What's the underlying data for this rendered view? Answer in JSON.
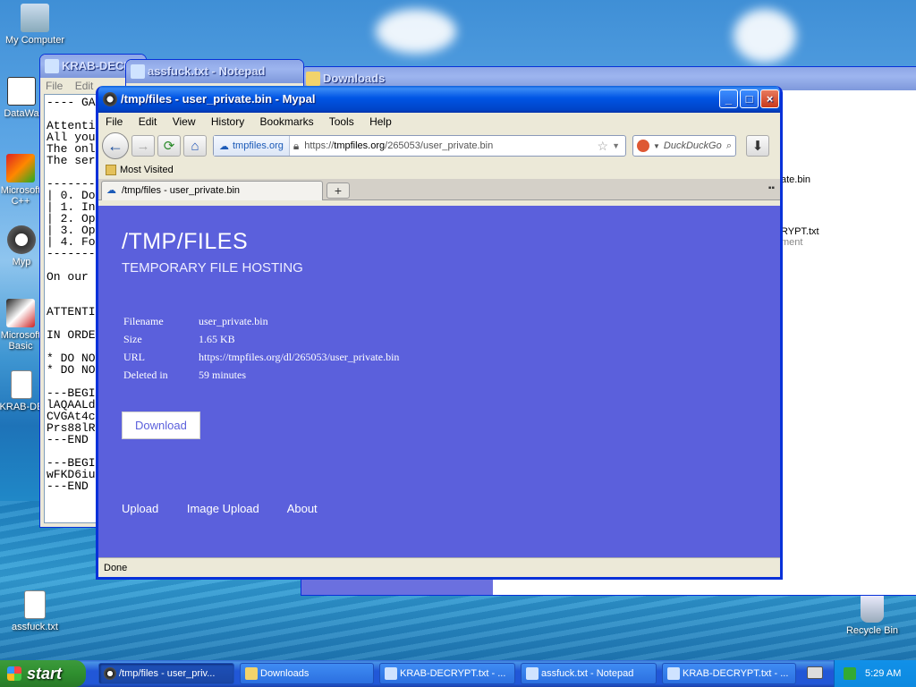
{
  "desktop": {
    "icons": [
      {
        "label": "My Computer"
      },
      {
        "label": "DataWa"
      },
      {
        "label": "Microsoft C++"
      },
      {
        "label": "Myp"
      },
      {
        "label": "Microsoft Basic"
      },
      {
        "label": "KRAB-DE"
      },
      {
        "label": "assfuck.txt"
      },
      {
        "label": "Recycle Bin"
      }
    ]
  },
  "bg_windows": {
    "krab_title": "KRAB-DECRY",
    "notepad_title": "assfuck.txt - Notepad",
    "notepad_menu": [
      "File",
      "Edit"
    ],
    "downloads_title": "Downloads",
    "downloads_item1": "ate.bin",
    "downloads_item2": "RYPT.txt",
    "downloads_item2_sub": "ment",
    "notepad_text": "---- GA\n\nAttenti\nAll you\nThe onl\nThe ser\n\n--------\n| 0. Do\n| 1. In\n| 2. Op\n| 3. Op\n| 4. Fo\n--------\n\nOn our\n\n\nATTENTI\n\nIN ORDE\n\n* DO NO\n* DO NO\n\n---BEGI\nlAQAALd\nCVGAt4c\nPrs88lR\n---END\n\n---BEGI\nwFKD6iu\n---END"
  },
  "browser": {
    "window_title": "/tmp/files - user_private.bin - Mypal",
    "menu": [
      "File",
      "Edit",
      "View",
      "History",
      "Bookmarks",
      "Tools",
      "Help"
    ],
    "site_identity": "tmpfiles.org",
    "url_prefix": "https://",
    "url_domain": "tmpfiles.org",
    "url_path": "/265053/user_private.bin",
    "search_placeholder": "DuckDuckGo",
    "bookmarks_item": "Most Visited",
    "tab_title": "/tmp/files - user_private.bin",
    "new_tab": "+",
    "status": "Done"
  },
  "page": {
    "title": "/TMP/FILES",
    "subtitle": "TEMPORARY FILE HOSTING",
    "fields": [
      {
        "key": "Filename",
        "value": "user_private.bin"
      },
      {
        "key": "Size",
        "value": "1.65 KB"
      },
      {
        "key": "URL",
        "value": "https://tmpfiles.org/dl/265053/user_private.bin"
      },
      {
        "key": "Deleted in",
        "value": "59 minutes"
      }
    ],
    "download_label": "Download",
    "footer_links": [
      "Upload",
      "Image Upload",
      "About"
    ]
  },
  "taskbar": {
    "start_label": "start",
    "buttons": [
      {
        "label": "/tmp/files - user_priv..."
      },
      {
        "label": "Downloads"
      },
      {
        "label": "KRAB-DECRYPT.txt - ..."
      },
      {
        "label": "assfuck.txt - Notepad"
      },
      {
        "label": "KRAB-DECRYPT.txt - ..."
      }
    ],
    "clock": "5:29 AM"
  },
  "colors": {
    "page_bg": "#5b60dc",
    "xp_title_blue": "#0055e5",
    "taskbar_blue": "#2157d7"
  }
}
